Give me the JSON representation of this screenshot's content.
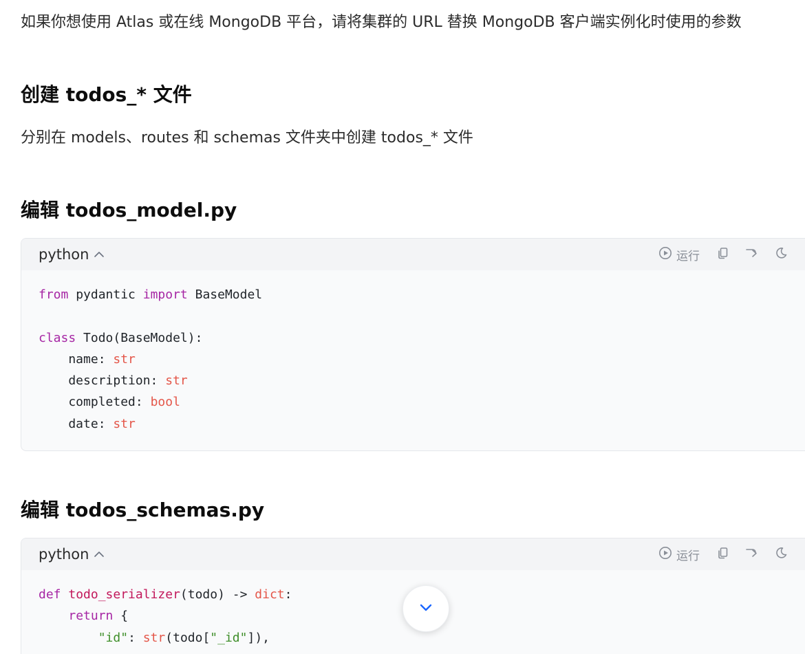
{
  "intro_text": "如果你想使用 Atlas 或在线 MongoDB 平台，请将集群的 URL 替换 MongoDB 客户端实例化时使用的参数",
  "section1": {
    "heading": "创建 todos_* 文件",
    "text": "分别在 models、routes 和 schemas 文件夹中创建 todos_* 文件"
  },
  "section2": {
    "heading": "编辑 todos_model.py",
    "code_block": {
      "language": "python",
      "run_label": "运行",
      "lines": [
        [
          {
            "t": "from",
            "c": "kw"
          },
          {
            "t": " pydantic "
          },
          {
            "t": "import",
            "c": "kw"
          },
          {
            "t": " BaseModel"
          }
        ],
        [],
        [
          {
            "t": "class",
            "c": "kw"
          },
          {
            "t": " Todo(BaseModel):"
          }
        ],
        [
          {
            "t": "    name: "
          },
          {
            "t": "str",
            "c": "ty"
          }
        ],
        [
          {
            "t": "    description: "
          },
          {
            "t": "str",
            "c": "ty"
          }
        ],
        [
          {
            "t": "    completed: "
          },
          {
            "t": "bool",
            "c": "ty"
          }
        ],
        [
          {
            "t": "    date: "
          },
          {
            "t": "str",
            "c": "ty"
          }
        ]
      ]
    }
  },
  "section3": {
    "heading": "编辑 todos_schemas.py",
    "code_block": {
      "language": "python",
      "run_label": "运行",
      "lines": [
        [
          {
            "t": "def",
            "c": "kw"
          },
          {
            "t": " "
          },
          {
            "t": "todo_serializer",
            "c": "fn"
          },
          {
            "t": "(todo) -> "
          },
          {
            "t": "dict",
            "c": "ty"
          },
          {
            "t": ":"
          }
        ],
        [
          {
            "t": "    "
          },
          {
            "t": "return",
            "c": "kw"
          },
          {
            "t": " {"
          }
        ],
        [
          {
            "t": "        "
          },
          {
            "t": "\"id\"",
            "c": "st"
          },
          {
            "t": ": "
          },
          {
            "t": "str",
            "c": "ty"
          },
          {
            "t": "(todo["
          },
          {
            "t": "\"_id\"",
            "c": "st"
          },
          {
            "t": "]),"
          }
        ]
      ]
    }
  },
  "icons": {
    "run": "play-circle-icon",
    "copy": "copy-icon",
    "wrap": "wrap-arrow-icon",
    "theme": "moon-icon",
    "scroll": "chevron-down-icon"
  },
  "colors": {
    "keyword": "#a626a4",
    "type": "#e45649",
    "function": "#c2185b",
    "string": "#3f8f2a",
    "accent": "#1a66ff"
  }
}
